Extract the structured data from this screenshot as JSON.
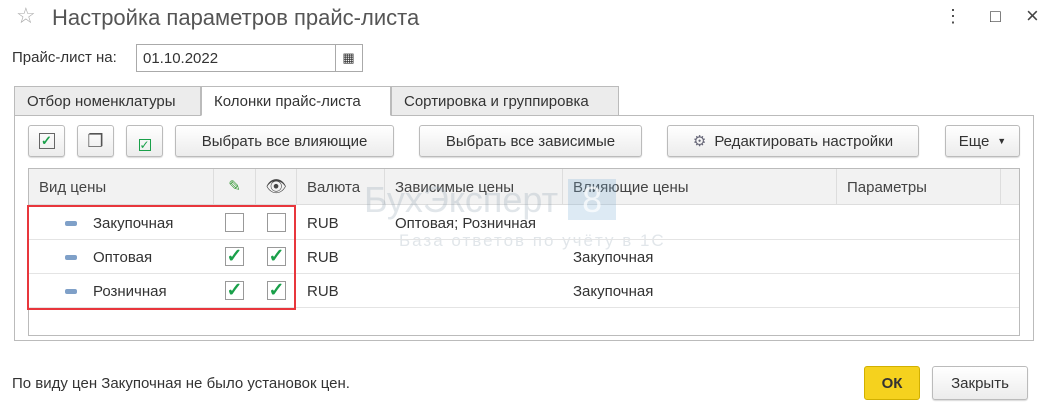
{
  "window": {
    "title": "Настройка параметров прайс-листа",
    "more_icon": "⋮",
    "maximize_icon": "□",
    "close_icon": "×"
  },
  "date": {
    "label": "Прайс-лист на:",
    "value": "01.10.2022"
  },
  "tabs": [
    {
      "label": "Отбор номенклатуры"
    },
    {
      "label": "Колонки прайс-листа"
    },
    {
      "label": "Сортировка и группировка"
    }
  ],
  "toolbar": {
    "select_influencing": "Выбрать все влияющие",
    "select_dependent": "Выбрать все зависимые",
    "edit_settings": "Редактировать настройки",
    "more": "Еще"
  },
  "table": {
    "headers": {
      "price_type": "Вид цены",
      "currency": "Валюта",
      "dependent": "Зависимые цены",
      "influencing": "Влияющие цены",
      "params": "Параметры"
    },
    "rows": [
      {
        "name": "Закупочная",
        "edit": false,
        "visible": false,
        "currency": "RUB",
        "dependent": "Оптовая; Розничная",
        "influencing": ""
      },
      {
        "name": "Оптовая",
        "edit": true,
        "visible": true,
        "currency": "RUB",
        "dependent": "",
        "influencing": "Закупочная"
      },
      {
        "name": "Розничная",
        "edit": true,
        "visible": true,
        "currency": "RUB",
        "dependent": "",
        "influencing": "Закупочная"
      }
    ]
  },
  "watermark": {
    "brand": "БухЭксперт",
    "digit": "8",
    "tagline": "База ответов по учёту в 1С"
  },
  "footer": {
    "message": "По виду цен Закупочная не было установок цен.",
    "ok": "ОК",
    "close": "Закрыть"
  }
}
